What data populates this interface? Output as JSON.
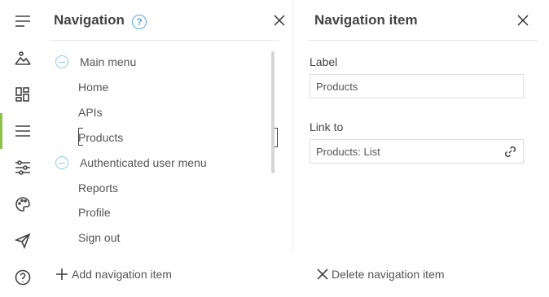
{
  "sidebar": {
    "icons": [
      "menu-lines-icon",
      "image-landscape-icon",
      "dashboard-grid-icon",
      "navigation-list-icon",
      "sliders-icon",
      "palette-icon",
      "send-plane-icon",
      "help-circle-icon"
    ],
    "active_color": "#8bc34a"
  },
  "navigation_panel": {
    "title": "Navigation",
    "help_glyph": "?",
    "groups": [
      {
        "label": "Main menu",
        "items": [
          "Home",
          "APIs",
          "Products"
        ]
      },
      {
        "label": "Authenticated user menu",
        "items": [
          "Reports",
          "Profile",
          "Sign out"
        ]
      }
    ],
    "selected_item": "Products",
    "add_label": "Add navigation item"
  },
  "item_panel": {
    "title": "Navigation item",
    "label_field": {
      "label": "Label",
      "value": "Products"
    },
    "link_field": {
      "label": "Link to",
      "value": "Products: List"
    },
    "delete_label": "Delete navigation item"
  },
  "colors": {
    "accent_blue": "#5aa9e6",
    "tree_icon": "#8cc8ef"
  }
}
